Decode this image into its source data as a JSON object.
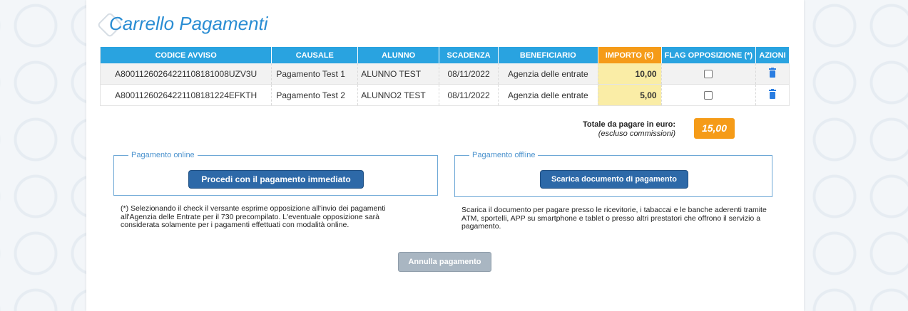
{
  "page": {
    "title": "Carrello Pagamenti"
  },
  "table": {
    "headers": {
      "code": "CODICE AVVISO",
      "cause": "CAUSALE",
      "student": "ALUNNO",
      "due": "SCADENZA",
      "beneficiary": "BENEFICIARIO",
      "amount": "IMPORTO (€)",
      "flag": "FLAG OPPOSIZIONE (*)",
      "actions": "AZIONI"
    },
    "rows": [
      {
        "code": "A800112602642211081810 08UZV3U",
        "cause": "Pagamento Test 1",
        "student": "ALUNNO TEST",
        "due": "08/11/2022",
        "beneficiary": "Agenzia delle entrate",
        "amount": "10,00",
        "flag_checked": false,
        "action_icon": "trash-icon"
      },
      {
        "code": "A800112602642211081812 24EFKTH",
        "cause": "Pagamento Test 2",
        "student": "ALUNNO2 TEST",
        "due": "08/11/2022",
        "beneficiary": "Agenzia delle entrate",
        "amount": "5,00",
        "flag_checked": false,
        "action_icon": "trash-icon"
      }
    ]
  },
  "total": {
    "label": "Totale da pagare in euro:",
    "sublabel": "(escluso commissioni)",
    "value": "15,00"
  },
  "online": {
    "legend": "Pagamento online",
    "button": "Procedi con il pagamento immediato",
    "note": "(*) Selezionando il check il versante esprime opposizione all'invio dei pagamenti all'Agenzia delle Entrate per il 730 precompilato. L'eventuale opposizione sarà considerata solamente per i pagamenti effettuati con modalità online."
  },
  "offline": {
    "legend": "Pagamento offline",
    "button": "Scarica documento di pagamento",
    "note": "Scarica il documento per pagare presso le ricevitorie, i tabaccai e le banche aderenti tramite ATM, sportelli, APP su smartphone e tablet o presso altri prestatori che offrono il servizio a pagamento."
  },
  "cancel_button": "Annulla pagamento",
  "colors": {
    "accent_blue": "#29a3e0",
    "amount_orange": "#f59b18",
    "amount_cell": "#faeda6",
    "button_blue": "#2d69a8",
    "cancel_grey": "#a9b6c2"
  }
}
